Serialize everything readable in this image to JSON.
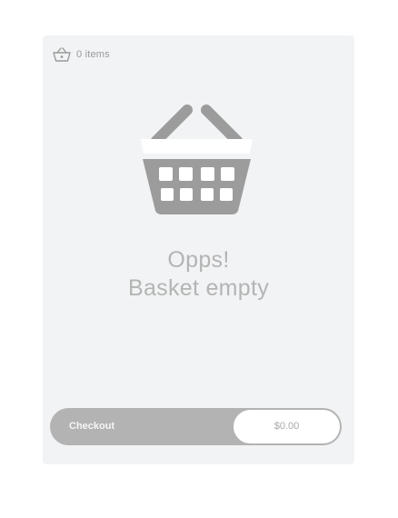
{
  "basket": {
    "icon": "basket-icon",
    "count_label": "0 items"
  },
  "empty_state": {
    "illustration": "empty-basket-illustration",
    "line1": "Opps!",
    "line2": "Basket empty"
  },
  "checkout": {
    "label": "Checkout",
    "total": "$0.00"
  },
  "colors": {
    "card_bg": "#f2f3f4",
    "grey": "#b3b3b3",
    "dark_grey": "#9c9c9c",
    "text_muted": "#b4b4b4"
  }
}
